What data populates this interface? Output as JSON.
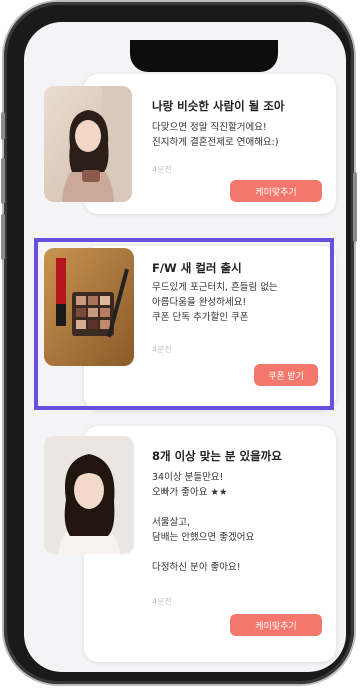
{
  "cards": [
    {
      "title": "나랑 비슷한 사람이 될 조아",
      "body": "다맞으면 정말 직진할거에요!\n진지하게 결혼전제로 연애해요:)",
      "time": "4분전",
      "button": "케미맞추기"
    },
    {
      "title": "F/W 새 컬러 출시",
      "body": "무드있게 포근터치, 흔들림 없는\n아름다움을 완성하세요!\n쿠폰 단독 추가할인 쿠폰",
      "time": "4분전",
      "button": "쿠폰 받기"
    },
    {
      "title": "8개 이상 맞는 분 있을까요",
      "body": "34이상 분들만요!\n오빠가 좋아요 ★★\n\n서울살고,\n담배는 안했으면 좋겠어요\n\n다정하신 분이 좋아요!",
      "time": "4분전",
      "button": "케미맞추기"
    }
  ],
  "colors": {
    "accent": "#f3776c",
    "highlight": "#6a4ee0"
  }
}
